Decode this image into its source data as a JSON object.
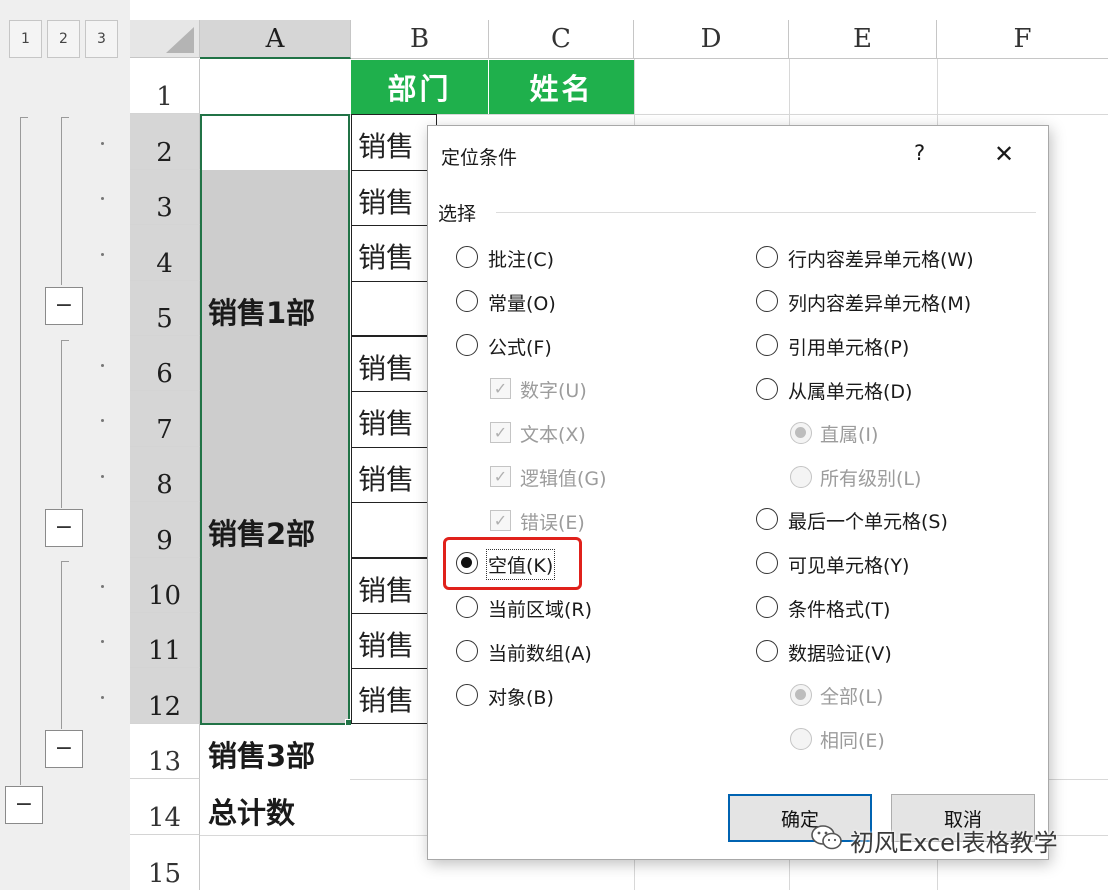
{
  "outline_levels": [
    "1",
    "2",
    "3"
  ],
  "columns": [
    "A",
    "B",
    "C",
    "D",
    "E",
    "F"
  ],
  "rows": [
    "1",
    "2",
    "3",
    "4",
    "5",
    "6",
    "7",
    "8",
    "9",
    "10",
    "11",
    "12",
    "13",
    "14",
    "15"
  ],
  "collapse_symbol": "−",
  "header_row": {
    "dept": "部门",
    "name": "姓名"
  },
  "colA": [
    "销售1部",
    "销售2部",
    "销售3部",
    "总计数"
  ],
  "colB_text": "销售",
  "dialog": {
    "title": "定位条件",
    "help": "?",
    "close": "✕",
    "section": "选择",
    "left_options": [
      "批注(C)",
      "常量(O)",
      "公式(F)",
      "空值(K)",
      "当前区域(R)",
      "当前数组(A)",
      "对象(B)"
    ],
    "formula_subs": [
      "数字(U)",
      "文本(X)",
      "逻辑值(G)",
      "错误(E)"
    ],
    "right_options": [
      "行内容差异单元格(W)",
      "列内容差异单元格(M)",
      "引用单元格(P)",
      "从属单元格(D)",
      "最后一个单元格(S)",
      "可见单元格(Y)",
      "条件格式(T)",
      "数据验证(V)"
    ],
    "dependents_subs": [
      "直属(I)",
      "所有级别(L)"
    ],
    "validation_subs": [
      "全部(L)",
      "相同(E)"
    ],
    "selected": "空值(K)",
    "ok": "确定",
    "cancel": "取消"
  },
  "watermark": "初风Excel表格教学",
  "colors": {
    "header_green": "#1fb04c",
    "highlight_red": "#e0211b",
    "selection_green": "#217346"
  }
}
